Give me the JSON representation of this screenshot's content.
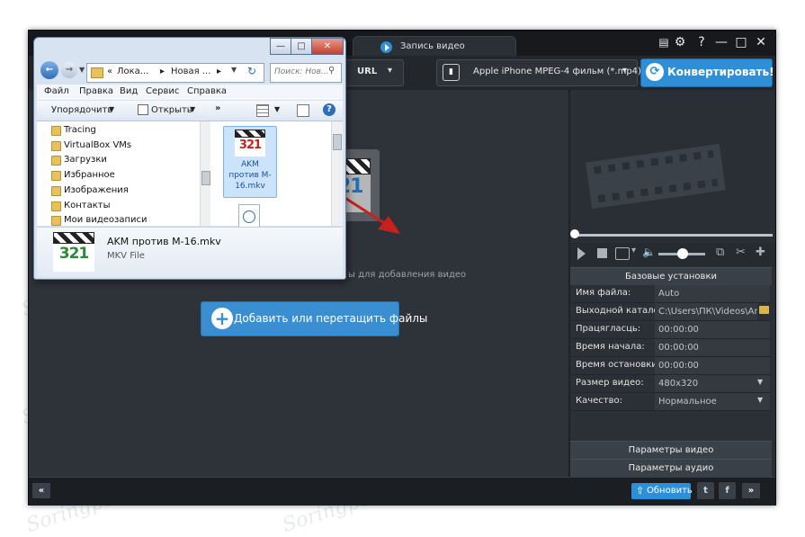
{
  "watermark": "Soringpcrpair.Com",
  "app": {
    "tab_record": "Запись видео",
    "url_label": "URL",
    "profile": "Apple iPhone MPEG-4 фильм (*.mp4)",
    "convert": "Конвертировать!",
    "drop_hint": "ы для добавления видео",
    "add_button": "Добавить или перетащить файлы",
    "bottom": {
      "update": "Обновить",
      "left": "«",
      "right": "»"
    },
    "settings": {
      "header": "Базовые установки",
      "rows": [
        {
          "label": "Имя файла:",
          "value": "Auto"
        },
        {
          "label": "Выходной каталог:",
          "value": "C:\\Users\\ПК\\Videos\\An..."
        },
        {
          "label": "Працягласць:",
          "value": "00:00:00"
        },
        {
          "label": "Время начала:",
          "value": "00:00:00"
        },
        {
          "label": "Время остановки:",
          "value": "00:00:00"
        },
        {
          "label": "Размер видео:",
          "value": "480x320"
        },
        {
          "label": "Качество:",
          "value": "Нормальное"
        }
      ],
      "video_params": "Параметры видео",
      "audio_params": "Параметры аудио"
    }
  },
  "explorer": {
    "breadcrumb": [
      "Лока...",
      "Новая ..."
    ],
    "search_placeholder": "Поиск: Нов...",
    "menu": [
      "Файл",
      "Правка",
      "Вид",
      "Сервис",
      "Справка"
    ],
    "organize": "Упорядочить",
    "open": "Открыть",
    "nav_items": [
      "Tracing",
      "VirtualBox VMs",
      "Загрузки",
      "Избранное",
      "Изображения",
      "Контакты",
      "Мои видеозаписи"
    ],
    "file_label": "AKM против M-16.mkv",
    "details_name": "AKM против M-16.mkv",
    "details_type": "MKV File"
  },
  "icon_text": "321"
}
